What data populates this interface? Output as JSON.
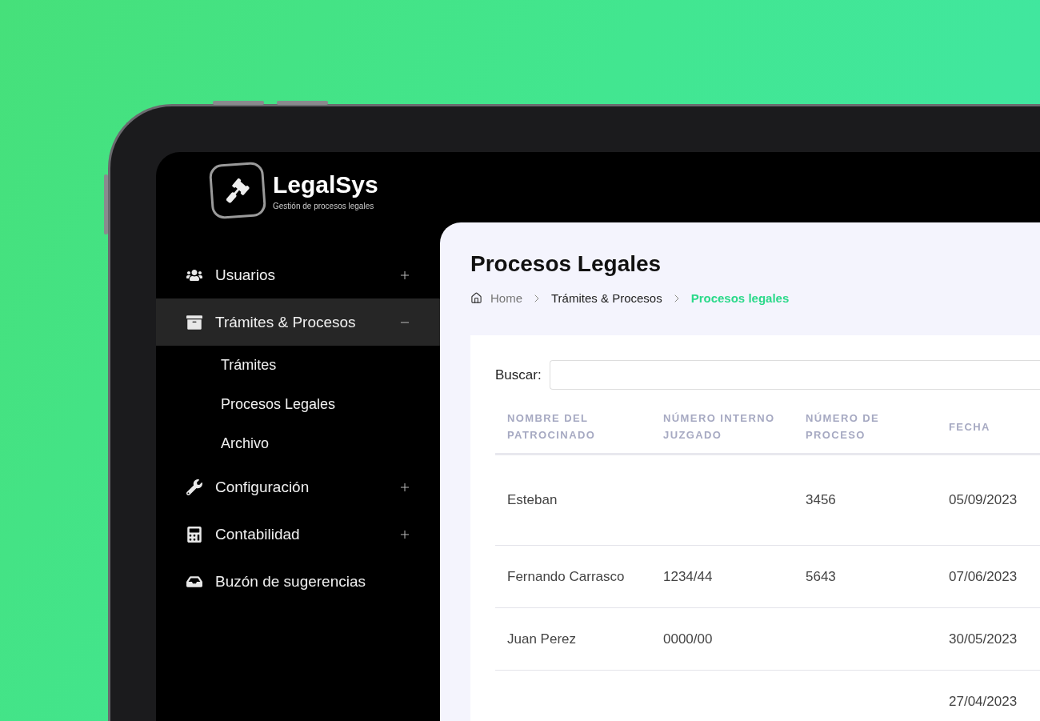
{
  "brand": {
    "name": "LegalSys",
    "tagline": "Gestión de procesos legales"
  },
  "sidebar": {
    "items": [
      {
        "label": "Usuarios",
        "kind": "group",
        "expanded": false,
        "selected": false
      },
      {
        "label": "Trámites & Procesos",
        "kind": "group",
        "expanded": true,
        "selected": true,
        "children": [
          {
            "label": "Trámites"
          },
          {
            "label": "Procesos Legales"
          },
          {
            "label": "Archivo"
          }
        ]
      },
      {
        "label": "Configuración",
        "kind": "group",
        "expanded": false,
        "selected": false
      },
      {
        "label": "Contabilidad",
        "kind": "group",
        "expanded": false,
        "selected": false
      },
      {
        "label": "Buzón de sugerencias",
        "kind": "link",
        "selected": false
      }
    ]
  },
  "page": {
    "title": "Procesos Legales",
    "breadcrumb": [
      {
        "label": "Home",
        "kind": "home",
        "selected": false
      },
      {
        "label": "Trámites & Procesos",
        "kind": "link",
        "selected": false
      },
      {
        "label": "Procesos legales",
        "kind": "link",
        "selected": true
      }
    ]
  },
  "search": {
    "label": "Buscar:"
  },
  "table": {
    "columns": [
      "NOMBRE DEL PATROCINADO",
      "NÚMERO INTERNO JUZGADO",
      "NÚMERO DE PROCESO",
      "FECHA"
    ],
    "rows": [
      {
        "nombre": "Esteban",
        "numero_proceso": "3456",
        "fecha": "05/09/2023"
      },
      {
        "nombre": "Fernando Carrasco",
        "numero_interno": "1234/44",
        "numero_proceso": "5643",
        "fecha": "07/06/2023"
      },
      {
        "nombre": "Juan Perez",
        "numero_interno": "0000/00",
        "fecha": "30/05/2023"
      },
      {
        "fecha": "27/04/2023"
      }
    ]
  }
}
